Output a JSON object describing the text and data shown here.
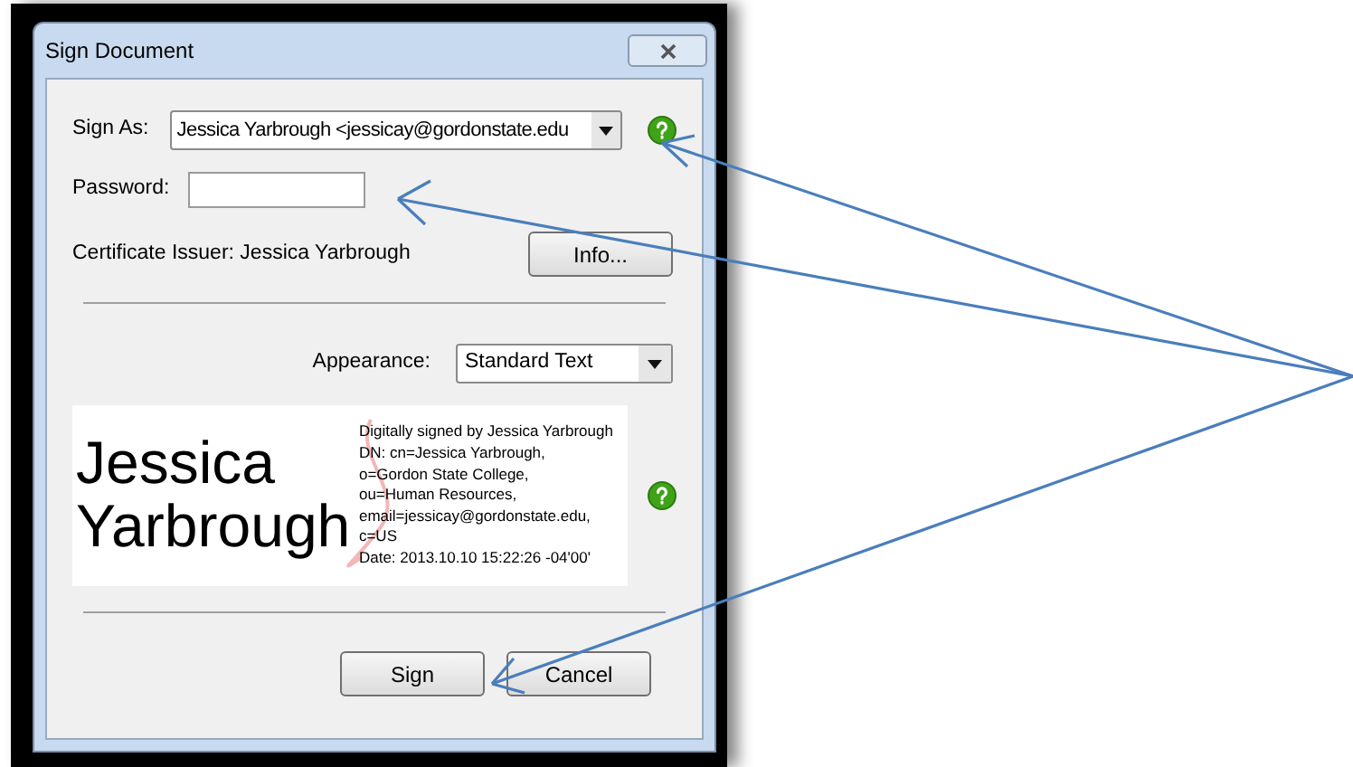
{
  "window": {
    "title": "Sign Document"
  },
  "sign_as": {
    "label": "Sign As:",
    "value": "Jessica Yarbrough <jessicay@gordonstate.edu"
  },
  "password": {
    "label": "Password:"
  },
  "certificate_issuer": "Certificate Issuer: Jessica Yarbrough",
  "info_button": "Info...",
  "appearance": {
    "label": "Appearance:",
    "value": "Standard Text"
  },
  "signature_preview": {
    "name_lines": [
      "Jessica",
      "Yarbrough"
    ],
    "details": [
      "Digitally signed by Jessica Yarbrough",
      "DN: cn=Jessica Yarbrough,",
      "o=Gordon State College,",
      "ou=Human Resources,",
      "email=jessicay@gordonstate.edu,",
      "c=US",
      "Date: 2013.10.10 15:22:26 -04'00'"
    ]
  },
  "buttons": [
    "Sign",
    "Cancel"
  ]
}
